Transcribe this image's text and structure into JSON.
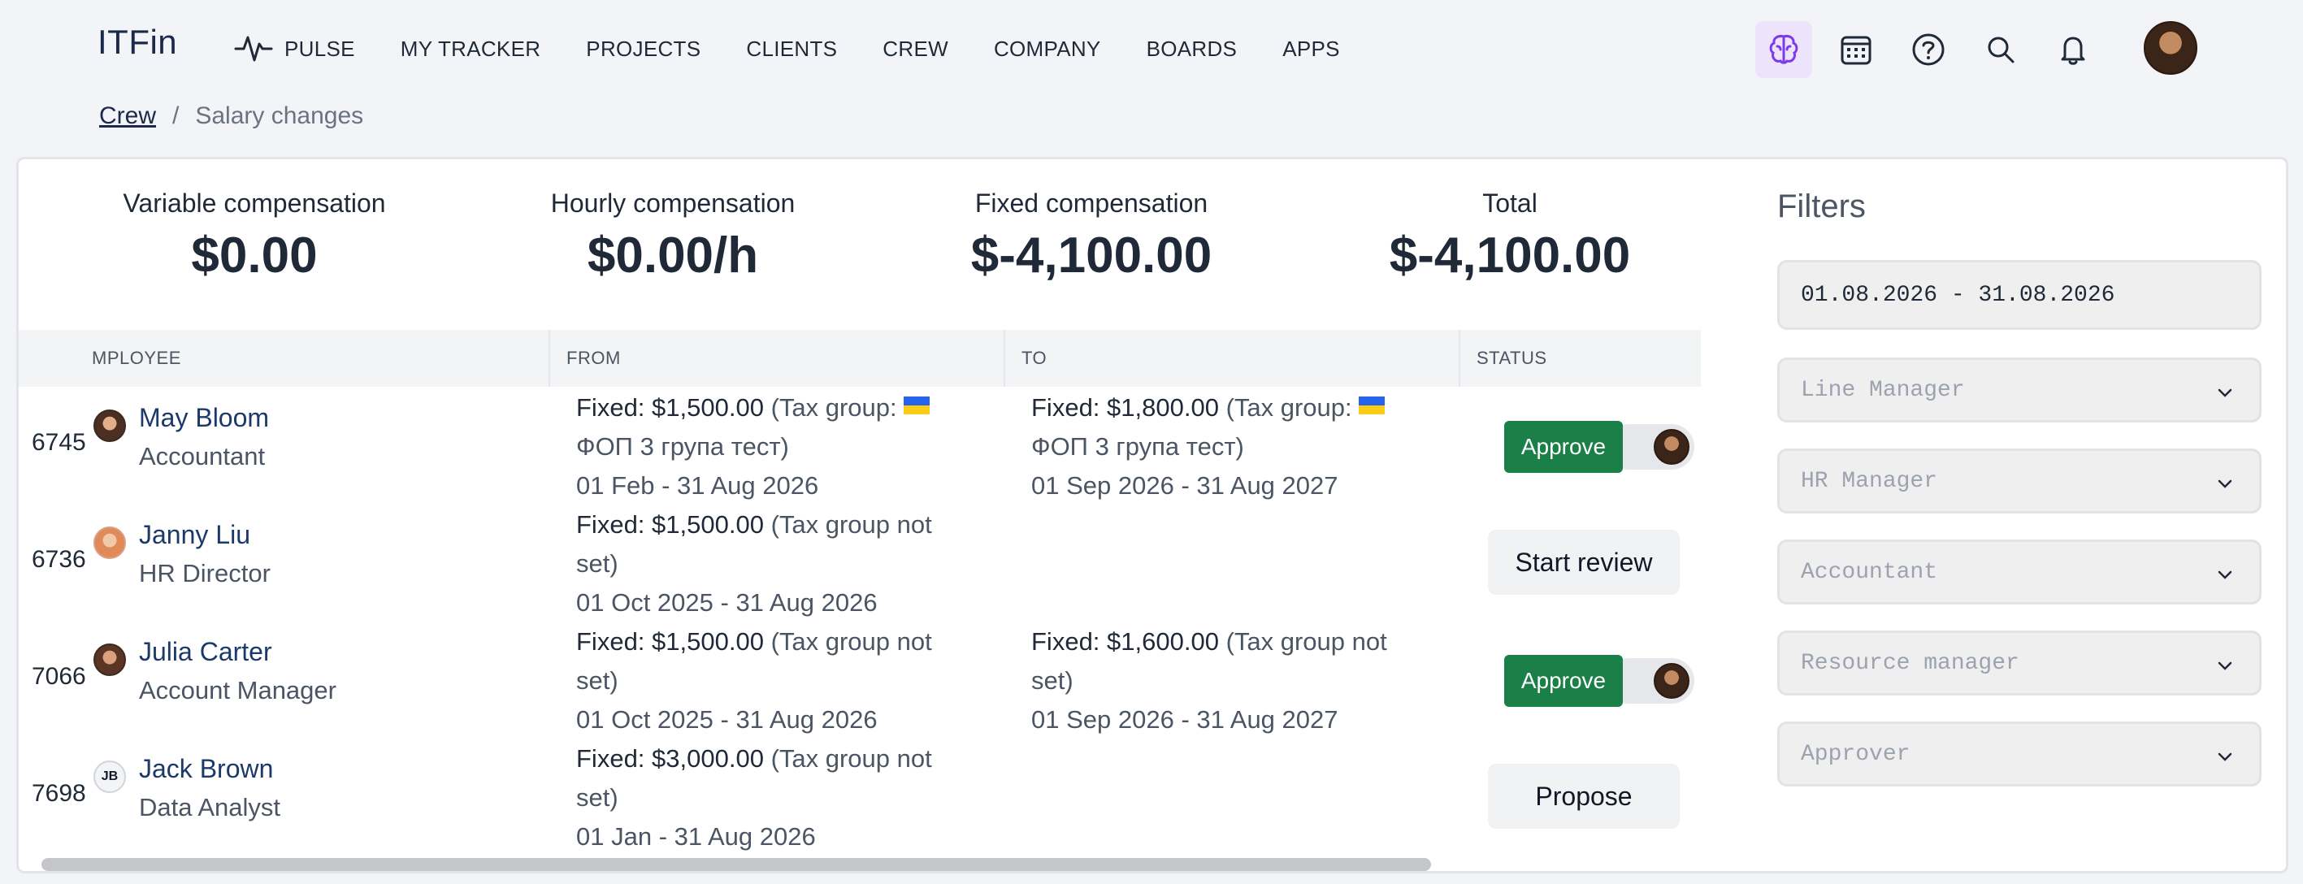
{
  "app": {
    "logo": "ITFin"
  },
  "nav": {
    "items": [
      {
        "label": "PULSE",
        "icon": "pulse-icon"
      },
      {
        "label": "MY TRACKER"
      },
      {
        "label": "PROJECTS"
      },
      {
        "label": "CLIENTS"
      },
      {
        "label": "CREW"
      },
      {
        "label": "COMPANY"
      },
      {
        "label": "BOARDS"
      },
      {
        "label": "APPS"
      }
    ],
    "icons": [
      "brain-icon",
      "calendar-icon",
      "help-icon",
      "search-icon",
      "bell-icon"
    ],
    "accent_active_bg": "#ede4fb",
    "accent_icon": "#7c3aed"
  },
  "breadcrumb": {
    "parent": "Crew",
    "separator": "/",
    "current": "Salary changes"
  },
  "summary": {
    "variable": {
      "label": "Variable compensation",
      "value": "$0.00"
    },
    "hourly": {
      "label": "Hourly compensation",
      "value": "$0.00/h"
    },
    "fixed": {
      "label": "Fixed compensation",
      "value": "$-4,100.00"
    },
    "total": {
      "label": "Total",
      "value": "$-4,100.00"
    }
  },
  "table": {
    "headers": {
      "employee": "MPLOYEE",
      "from": "FROM",
      "to": "TO",
      "status": "STATUS"
    },
    "rows": [
      {
        "id": "6745",
        "name": "May Bloom",
        "role": "Accountant",
        "from": {
          "fixed": "Fixed: $1,500.00",
          "tax": " (Tax group: ",
          "tax_name": "ФОП 3 група тест)",
          "period": "01 Feb - 31 Aug 2026",
          "flag": true
        },
        "to": {
          "fixed": "Fixed: $1,800.00",
          "tax": " (Tax group: ",
          "tax_name": "ФОП 3 група тест)",
          "period": "01 Sep 2026 - 31 Aug 2027",
          "flag": true
        },
        "action": "Approve"
      },
      {
        "id": "6736",
        "name": "Janny Liu",
        "role": "HR Director",
        "from": {
          "fixed": "Fixed: $1,500.00",
          "tax": " (Tax group not set)",
          "period": "01 Oct 2025 - 31 Aug 2026"
        },
        "to": null,
        "action": "Start review"
      },
      {
        "id": "7066",
        "name": "Julia Carter",
        "role": "Account Manager",
        "from": {
          "fixed": "Fixed: $1,500.00",
          "tax": " (Tax group not set)",
          "period": "01 Oct 2025 - 31 Aug 2026"
        },
        "to": {
          "fixed": "Fixed: $1,600.00",
          "tax": " (Tax group not set)",
          "period": "01 Sep 2026 - 31 Aug 2027"
        },
        "action": "Approve"
      },
      {
        "id": "7698",
        "name": "Jack Brown",
        "role": "Data Analyst",
        "initials": "JB",
        "from": {
          "fixed": "Fixed: $3,000.00",
          "tax": " (Tax group not set)",
          "period": "01 Jan - 31 Aug 2026"
        },
        "to": null,
        "action": "Propose"
      }
    ]
  },
  "filters": {
    "title": "Filters",
    "date_range": "01.08.2026 - 31.08.2026",
    "selects": [
      "Line Manager",
      "HR Manager",
      "Accountant",
      "Resource manager",
      "Approver"
    ]
  },
  "colors": {
    "approve": "#1a8048",
    "link": "#1b3a6b",
    "page_bg": "#f3f4f7"
  }
}
